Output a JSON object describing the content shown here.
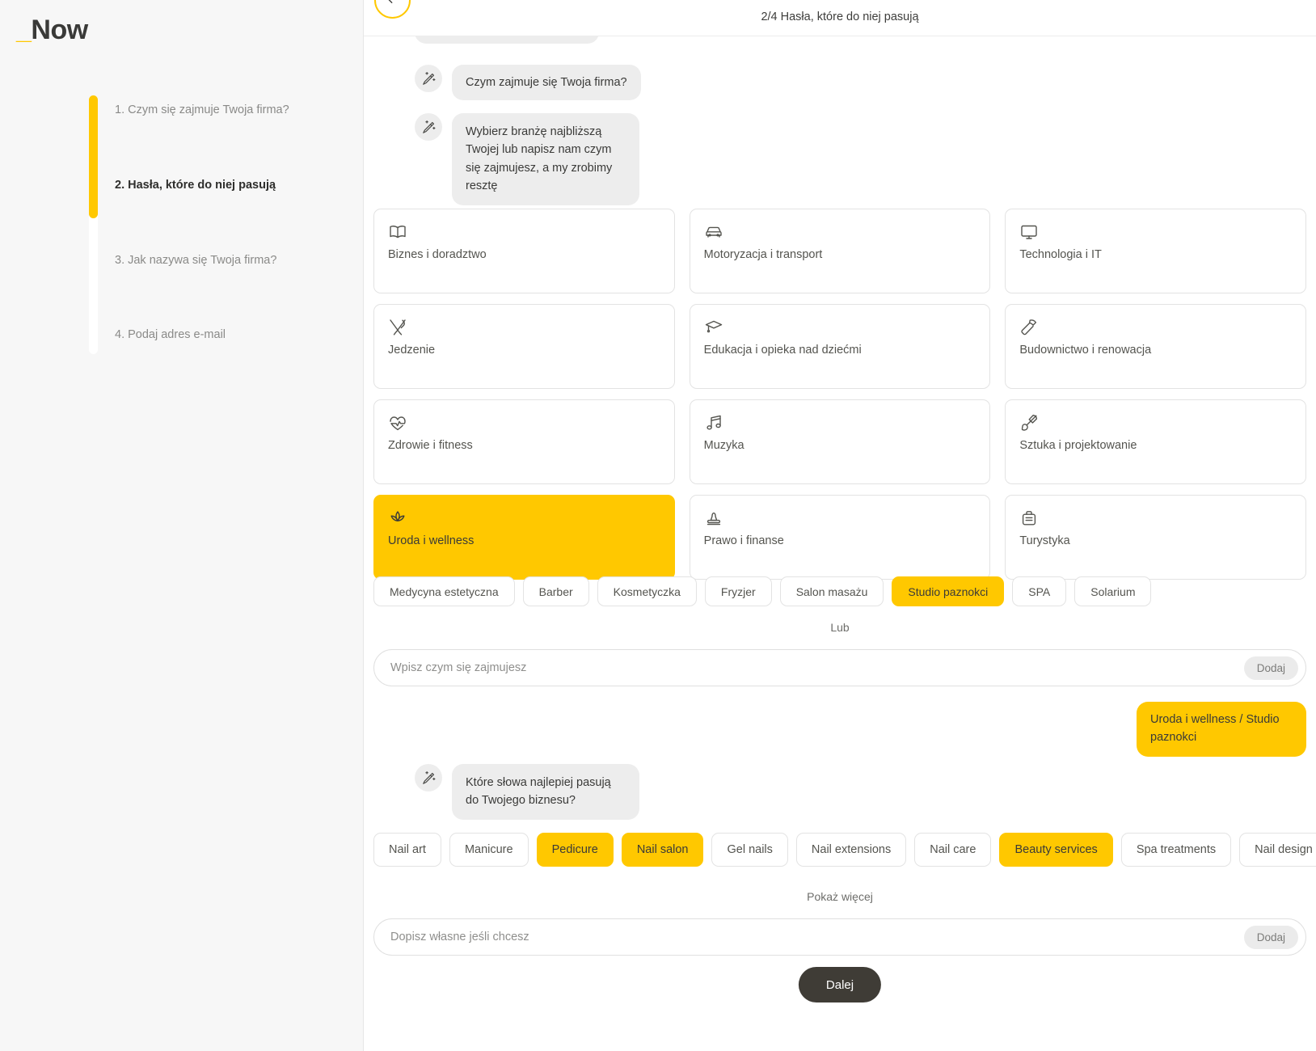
{
  "brand": {
    "underscore": "_",
    "name": "Now"
  },
  "sidebar": {
    "steps": [
      {
        "label": "1. Czym się zajmuje Twoja firma?",
        "active": false
      },
      {
        "label": "2. Hasła, które do niej pasują",
        "active": true
      },
      {
        "label": "3. Jak nazywa się Twoja firma?",
        "active": false
      },
      {
        "label": "4. Podaj adres e-mail",
        "active": false
      }
    ]
  },
  "topbar": {
    "title": "2/4 Hasła, które do niej pasują",
    "back_icon": "arrow-left-icon"
  },
  "chat": {
    "assistant_icon": "magic-wand-icon",
    "messages": [
      {
        "text": "Czym zajmuje się Twoja firma?",
        "from": "assistant"
      },
      {
        "text": "Wybierz branżę najbliższą Twojej lub napisz nam czym się zajmujesz, a my zrobimy resztę",
        "from": "assistant"
      },
      {
        "text": "Uroda i wellness / Studio paznokci",
        "from": "user"
      },
      {
        "text": "Które słowa najlepiej pasują do Twojego biznesu?",
        "from": "assistant"
      }
    ]
  },
  "categories": [
    {
      "label": "Biznes i doradztwo",
      "icon": "book-icon",
      "selected": false
    },
    {
      "label": "Motoryzacja i transport",
      "icon": "car-icon",
      "selected": false
    },
    {
      "label": "Technologia i IT",
      "icon": "monitor-icon",
      "selected": false
    },
    {
      "label": "Jedzenie",
      "icon": "cutlery-icon",
      "selected": false
    },
    {
      "label": "Edukacja i opieka nad dziećmi",
      "icon": "graduation-cap-icon",
      "selected": false
    },
    {
      "label": "Budownictwo i renowacja",
      "icon": "hammer-icon",
      "selected": false
    },
    {
      "label": "Zdrowie i fitness",
      "icon": "heart-pulse-icon",
      "selected": false
    },
    {
      "label": "Muzyka",
      "icon": "music-note-icon",
      "selected": false
    },
    {
      "label": "Sztuka i projektowanie",
      "icon": "paint-brush-icon",
      "selected": false
    },
    {
      "label": "Uroda i wellness",
      "icon": "lotus-flower-icon",
      "selected": true
    },
    {
      "label": "Prawo i finanse",
      "icon": "stamp-icon",
      "selected": false
    },
    {
      "label": "Turystyka",
      "icon": "suitcase-icon",
      "selected": false
    }
  ],
  "subcategories": [
    {
      "label": "Medycyna estetyczna",
      "selected": false
    },
    {
      "label": "Barber",
      "selected": false
    },
    {
      "label": "Kosmetyczka",
      "selected": false
    },
    {
      "label": "Fryzjer",
      "selected": false
    },
    {
      "label": "Salon masażu",
      "selected": false
    },
    {
      "label": "Studio paznokci",
      "selected": true
    },
    {
      "label": "SPA",
      "selected": false
    },
    {
      "label": "Solarium",
      "selected": false
    }
  ],
  "or_label": "Lub",
  "industry_input": {
    "placeholder": "Wpisz czym się zajmujesz",
    "value": "",
    "add_label": "Dodaj"
  },
  "keywords": [
    {
      "label": "Nail art",
      "selected": false
    },
    {
      "label": "Manicure",
      "selected": false
    },
    {
      "label": "Pedicure",
      "selected": true
    },
    {
      "label": "Nail salon",
      "selected": true
    },
    {
      "label": "Gel nails",
      "selected": false
    },
    {
      "label": "Nail extensions",
      "selected": false
    },
    {
      "label": "Nail care",
      "selected": false
    },
    {
      "label": "Beauty services",
      "selected": true
    },
    {
      "label": "Spa treatments",
      "selected": false
    },
    {
      "label": "Nail design",
      "selected": false
    }
  ],
  "show_more_label": "Pokaż więcej",
  "keyword_input": {
    "placeholder": "Dopisz własne jeśli chcesz",
    "value": "",
    "add_label": "Dodaj"
  },
  "next_button": {
    "label": "Dalej"
  },
  "colors": {
    "accent": "#ffc800",
    "dark": "#3f3c36",
    "bubble": "#ededed",
    "sidebar_bg": "#f7f7f7",
    "border": "#e3e3e3"
  }
}
